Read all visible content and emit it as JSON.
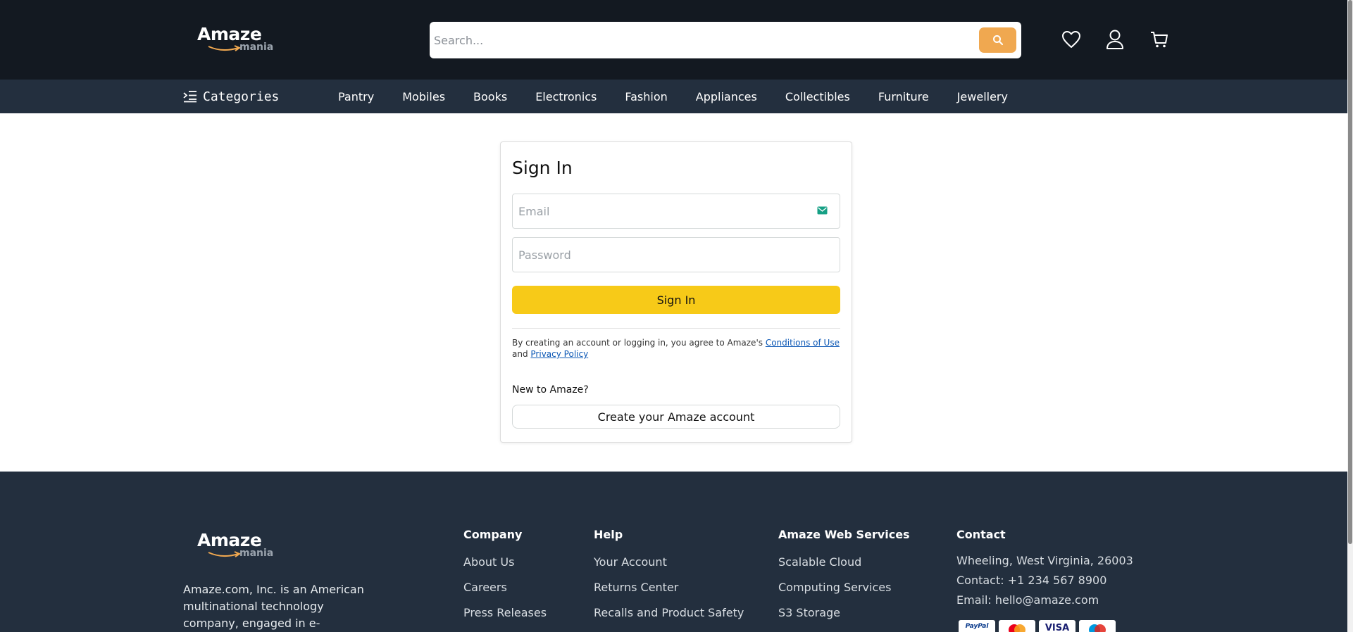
{
  "header": {
    "logo": {
      "brand": "Amaze",
      "sub": "mania"
    },
    "search": {
      "placeholder": "Search..."
    },
    "icons": {
      "wishlist": "heart-icon",
      "account": "user-icon",
      "cart": "cart-icon",
      "search": "search-icon"
    },
    "accent": "#f0a850",
    "background": "#131921"
  },
  "nav": {
    "categories_label": "Categories",
    "links": [
      "Pantry",
      "Mobiles",
      "Books",
      "Electronics",
      "Fashion",
      "Appliances",
      "Collectibles",
      "Furniture",
      "Jewellery"
    ],
    "background": "#232f3e"
  },
  "signin": {
    "title": "Sign In",
    "email_placeholder": "Email",
    "password_placeholder": "Password",
    "button_label": "Sign In",
    "button_color": "#f7ca18",
    "terms_prefix": "By creating an account or logging in, you agree to Amaze's",
    "conditions_link": "Conditions of Use",
    "terms_and": "and",
    "privacy_link": "Privacy Policy",
    "new_to": "New to Amaze?",
    "create_button": "Create your Amaze account"
  },
  "footer": {
    "logo": {
      "brand": "Amaze",
      "sub": "mania"
    },
    "about": "Amaze.com, Inc. is an American multinational technology company, engaged in e-commerce, cloud",
    "columns": [
      {
        "title": "Company",
        "links": [
          "About Us",
          "Careers",
          "Press Releases"
        ]
      },
      {
        "title": "Help",
        "links": [
          "Your Account",
          "Returns Center",
          "Recalls and Product Safety"
        ]
      },
      {
        "title": "Amaze Web Services",
        "links": [
          "Scalable Cloud",
          "Computing Services",
          "S3 Storage"
        ]
      }
    ],
    "contact": {
      "title": "Contact",
      "address": "Wheeling, West Virginia, 26003",
      "phone": "Contact: +1 234 567 8900",
      "email": "Email: hello@amaze.com"
    },
    "payment_cards": [
      "PayPal",
      "Mastercard",
      "VISA",
      "Maestro"
    ]
  }
}
